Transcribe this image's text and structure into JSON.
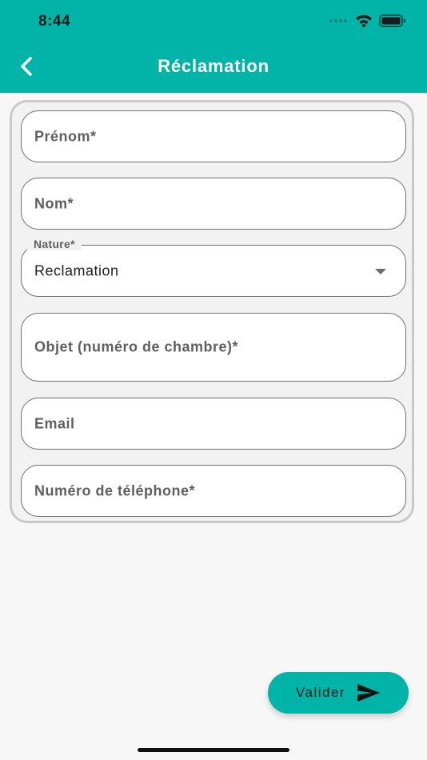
{
  "status_bar": {
    "time": "8:44"
  },
  "header": {
    "title": "Réclamation",
    "back_icon": "chevron-left-icon"
  },
  "form": {
    "fields": [
      {
        "placeholder": "Prénom*"
      },
      {
        "placeholder": "Nom*"
      },
      {
        "label": "Nature*",
        "value": "Reclamation"
      },
      {
        "placeholder": "Objet (numéro de chambre)*"
      },
      {
        "placeholder": "Email"
      },
      {
        "placeholder": "Numéro de téléphone*"
      }
    ]
  },
  "actions": {
    "submit_label": "Valider",
    "submit_icon": "send-icon"
  },
  "colors": {
    "accent": "#02b3a8",
    "background": "#f7f7f7",
    "card": "#f2f2f2"
  }
}
